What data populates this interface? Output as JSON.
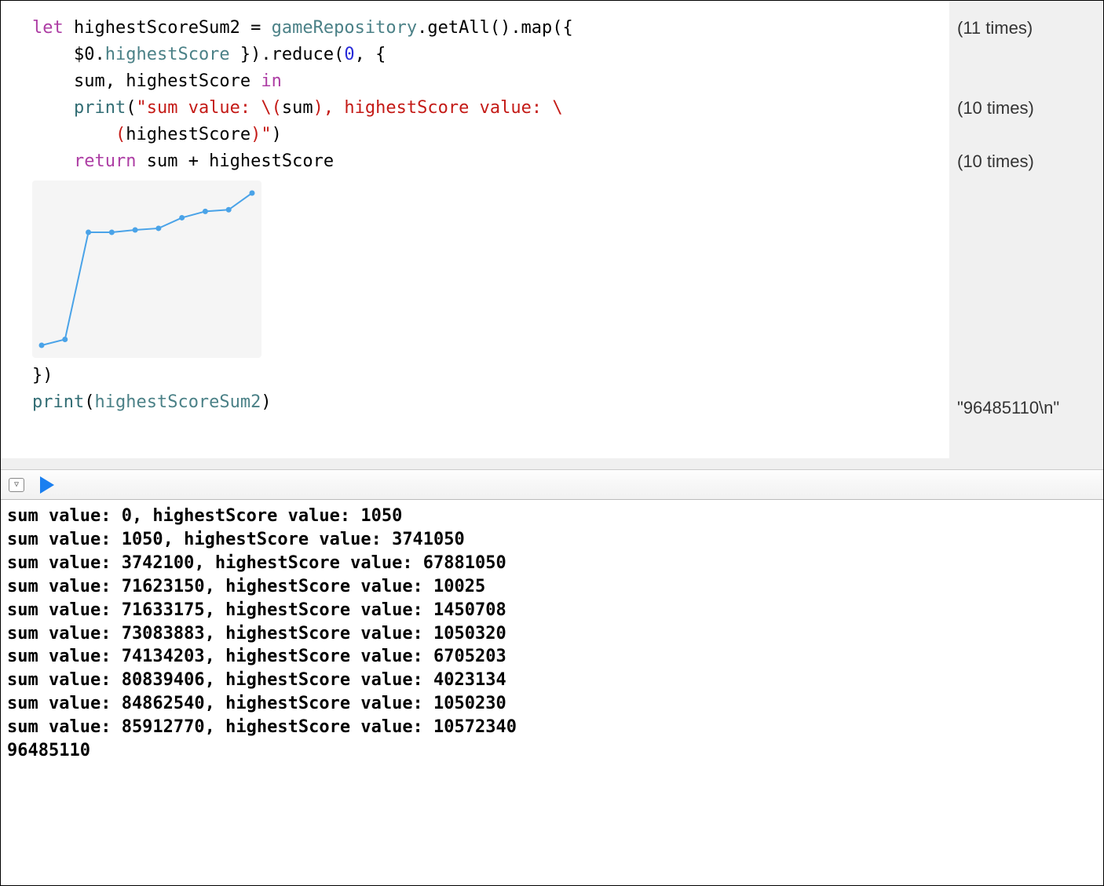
{
  "code": {
    "line1": {
      "let": "let",
      "v": " highestScoreSum2 ",
      "eq": "= ",
      "repo": "gameRepository",
      "call": ".getAll().map({"
    },
    "line2": {
      "indent": "    ",
      "d0": "$0",
      "dot": ".",
      "prop": "highestScore",
      "rest": " }).reduce(",
      "zero": "0",
      "tail": ", {"
    },
    "line3": {
      "indent": "    ",
      "txt": "sum, highestScore ",
      "in": "in"
    },
    "line4": {
      "indent": "    ",
      "pr": "print",
      "open": "(",
      "s1": "\"sum value: ",
      "esc1": "\\(",
      "sum": "sum",
      "mid": ")",
      "s2": ", highestScore value: ",
      "esc2": "\\"
    },
    "line5": {
      "indent": "        ",
      "open": "(",
      "hs": "highestScore",
      "close": ")",
      "q": "\"",
      "paren": ")"
    },
    "line6": {
      "indent": "    ",
      "ret": "return",
      "rest": " sum + highestScore"
    },
    "line7": "})",
    "line8": {
      "pr": "print",
      "open": "(",
      "v": "highestScoreSum2",
      "close": ")"
    }
  },
  "results": {
    "r1": "(11 times)",
    "r2": "(10 times)",
    "r3": "(10 times)",
    "r4": "\"96485110\\n\""
  },
  "chart_data": {
    "type": "line",
    "x": [
      0,
      1,
      2,
      3,
      4,
      5,
      6,
      7,
      8,
      9
    ],
    "values": [
      1050,
      3742100,
      71623150,
      71633175,
      73083883,
      74134203,
      80839406,
      84862540,
      85912770,
      96485110
    ],
    "title": "",
    "xlabel": "",
    "ylabel": "",
    "ylim": [
      0,
      100000000
    ]
  },
  "console_lines": [
    "sum value: 0, highestScore value: 1050",
    "sum value: 1050, highestScore value: 3741050",
    "sum value: 3742100, highestScore value: 67881050",
    "sum value: 71623150, highestScore value: 10025",
    "sum value: 71633175, highestScore value: 1450708",
    "sum value: 73083883, highestScore value: 1050320",
    "sum value: 74134203, highestScore value: 6705203",
    "sum value: 80839406, highestScore value: 4023134",
    "sum value: 84862540, highestScore value: 1050230",
    "sum value: 85912770, highestScore value: 10572340",
    "96485110"
  ],
  "colors": {
    "line": "#4aa3e8",
    "point": "#4aa3e8"
  }
}
